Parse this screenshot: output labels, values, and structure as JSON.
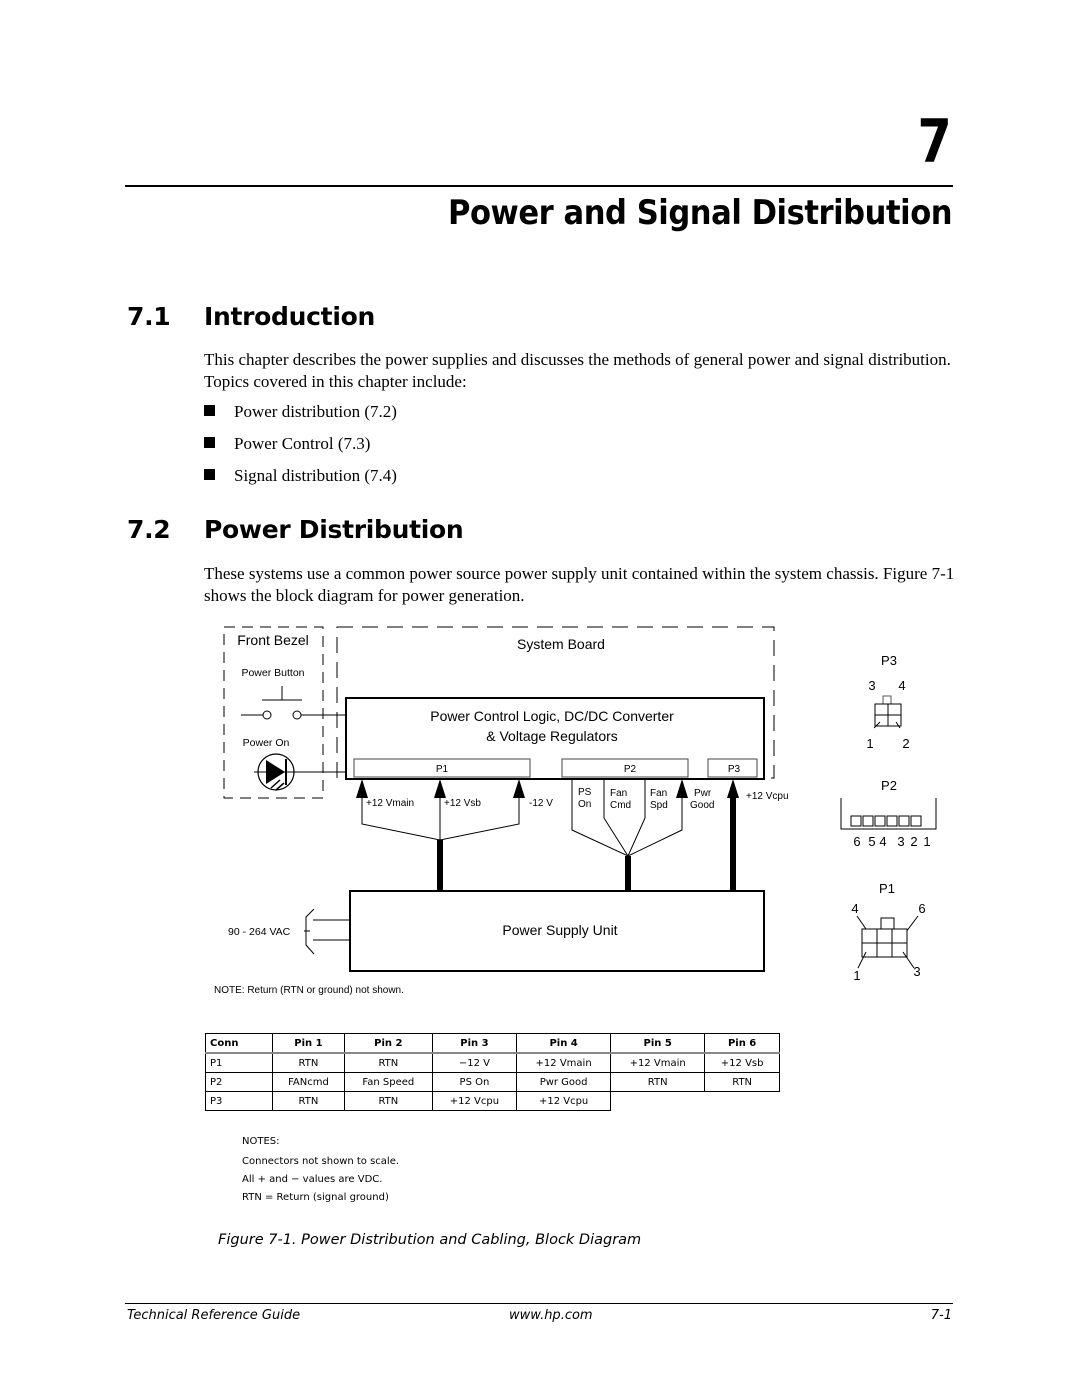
{
  "chapter": {
    "number": "7",
    "title": "Power and Signal Distribution"
  },
  "sections": [
    {
      "number": "7.1",
      "title": "Introduction",
      "paragraph": "This chapter describes the power supplies and discusses the methods of general power and signal distribution. Topics covered in this chapter include:",
      "bullets": [
        "Power distribution (7.2)",
        "Power Control (7.3)",
        "Signal distribution (7.4)"
      ]
    },
    {
      "number": "7.2",
      "title": "Power Distribution",
      "paragraph": "These systems use a common power source power supply unit contained within the system chassis. Figure 7-1 shows the block diagram for power generation."
    }
  ],
  "diagram": {
    "front_bezel": "Front Bezel",
    "power_button": "Power Button",
    "power_on": "Power On",
    "system_board": "System Board",
    "control_logic_line1": "Power Control Logic, DC/DC Converter",
    "control_logic_line2": "& Voltage Regulators",
    "connectors": {
      "p1": "P1",
      "p2": "P2",
      "p3": "P3"
    },
    "p1_signals": [
      "+12 Vmain",
      "+12 Vsb",
      "-12 V"
    ],
    "p2_signals": [
      {
        "line1": "PS",
        "line2": "On"
      },
      {
        "line1": "Fan",
        "line2": "Cmd"
      },
      {
        "line1": "Fan",
        "line2": "Spd"
      },
      {
        "line1": "Pwr",
        "line2": "Good"
      }
    ],
    "p3_signal": "+12 Vcpu",
    "psu": "Power Supply Unit",
    "ac_input": "90 - 264 VAC",
    "note": "NOTE: Return (RTN or ground) not shown.",
    "pinouts": {
      "p3": {
        "label": "P3",
        "pins_top": [
          "3",
          "4"
        ],
        "pins_bottom": [
          "1",
          "2"
        ]
      },
      "p2": {
        "label": "P2",
        "pins": [
          "6",
          "5",
          "4",
          "3",
          "2",
          "1"
        ]
      },
      "p1": {
        "label": "P1",
        "pins_top": [
          "4",
          "6"
        ],
        "pins_bottom": [
          "1",
          "3"
        ]
      }
    }
  },
  "pin_table": {
    "headers": [
      "Conn",
      "Pin 1",
      "Pin 2",
      "Pin 3",
      "Pin 4",
      "Pin 5",
      "Pin 6"
    ],
    "rows": [
      [
        "P1",
        "RTN",
        "RTN",
        "−12 V",
        "+12 Vmain",
        "+12 Vmain",
        "+12 Vsb"
      ],
      [
        "P2",
        "FANcmd",
        "Fan Speed",
        "PS On",
        "Pwr Good",
        "RTN",
        "RTN"
      ],
      [
        "P3",
        "RTN",
        "RTN",
        "+12 Vcpu",
        "+12 Vcpu"
      ]
    ]
  },
  "notes": {
    "heading": "NOTES:",
    "lines": [
      "Connectors not shown to scale.",
      "All + and − values are VDC.",
      "RTN = Return (signal ground)"
    ]
  },
  "figure_caption": "Figure 7-1. Power Distribution and Cabling, Block Diagram",
  "footer": {
    "left": "Technical Reference Guide",
    "center": "www.hp.com",
    "right": "7-1"
  }
}
